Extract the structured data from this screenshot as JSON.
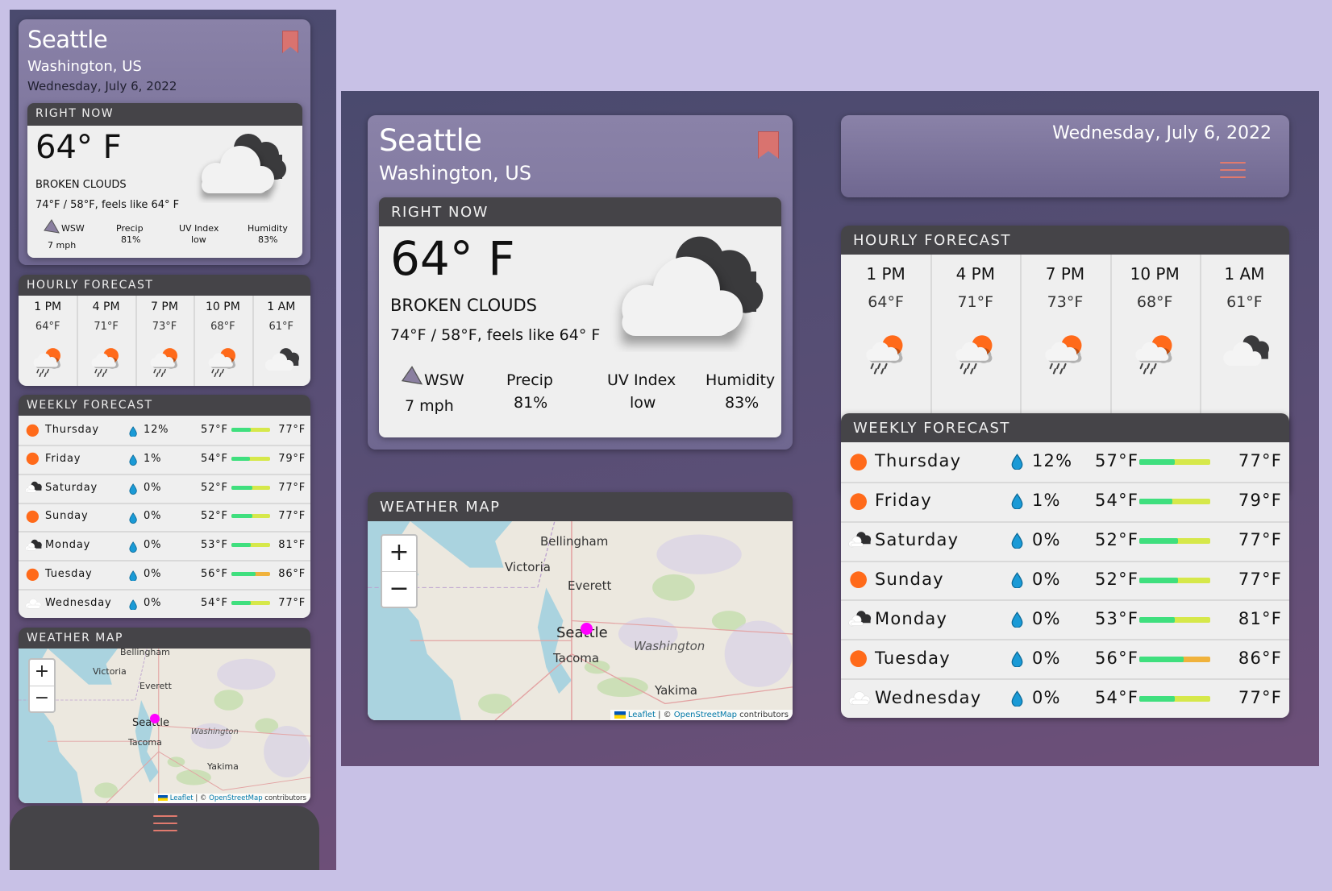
{
  "location": {
    "city": "Seattle",
    "region": "Washington, US",
    "date": "Wednesday, July 6, 2022"
  },
  "current": {
    "heading": "RIGHT NOW",
    "temp": "64° F",
    "condition": "BROKEN CLOUDS",
    "range": "74°F / 58°F, feels like 64° F",
    "wind_dir": "WSW",
    "wind_speed": "7 mph",
    "precip_label": "Precip",
    "precip_value": "81%",
    "uv_label": "UV Index",
    "uv_value": "low",
    "humidity_label": "Humidity",
    "humidity_value": "83%",
    "icon": "broken-clouds-icon"
  },
  "hourly": {
    "heading": "HOURLY FORECAST",
    "items": [
      {
        "time": "1 PM",
        "temp": "64°F",
        "icon": "rain-sun-icon"
      },
      {
        "time": "4 PM",
        "temp": "71°F",
        "icon": "rain-sun-icon"
      },
      {
        "time": "7 PM",
        "temp": "73°F",
        "icon": "rain-sun-icon"
      },
      {
        "time": "10 PM",
        "temp": "68°F",
        "icon": "rain-sun-icon"
      },
      {
        "time": "1 AM",
        "temp": "61°F",
        "icon": "broken-clouds-icon"
      }
    ]
  },
  "weekly": {
    "heading": "WEEKLY FORECAST",
    "days": [
      {
        "day": "Thursday",
        "precip": "12%",
        "low": "57°F",
        "high": "77°F",
        "icon": "sun-icon",
        "fill": 0.5,
        "track": "#d6e84a"
      },
      {
        "day": "Friday",
        "precip": "1%",
        "low": "54°F",
        "high": "79°F",
        "icon": "sun-icon",
        "fill": 0.47,
        "track": "#d6e84a"
      },
      {
        "day": "Saturday",
        "precip": "0%",
        "low": "52°F",
        "high": "77°F",
        "icon": "clouds-icon",
        "fill": 0.55,
        "track": "#d6e84a"
      },
      {
        "day": "Sunday",
        "precip": "0%",
        "low": "52°F",
        "high": "77°F",
        "icon": "sun-icon",
        "fill": 0.55,
        "track": "#d6e84a"
      },
      {
        "day": "Monday",
        "precip": "0%",
        "low": "53°F",
        "high": "81°F",
        "icon": "clouds-icon",
        "fill": 0.5,
        "track": "#d6e84a"
      },
      {
        "day": "Tuesday",
        "precip": "0%",
        "low": "56°F",
        "high": "86°F",
        "icon": "sun-icon",
        "fill": 0.62,
        "track": "#f0b23c"
      },
      {
        "day": "Wednesday",
        "precip": "0%",
        "low": "54°F",
        "high": "77°F",
        "icon": "cloud-icon",
        "fill": 0.5,
        "track": "#d6e84a"
      }
    ]
  },
  "map": {
    "heading": "WEATHER MAP",
    "zoom_in": "+",
    "zoom_out": "−",
    "labels": [
      "Bellingham",
      "Victoria",
      "Everett",
      "Seattle",
      "Washington",
      "Tacoma",
      "Yakima"
    ],
    "attr_leaflet": "Leaflet",
    "attr_sep": " | © ",
    "attr_osm": "OpenStreetMap",
    "attr_contrib": " contributors",
    "marker_color": "#ff00ff"
  },
  "colors": {
    "accent": "#e07a6e",
    "sun": "#ff6a1a",
    "drop": "#1a9ad6"
  }
}
